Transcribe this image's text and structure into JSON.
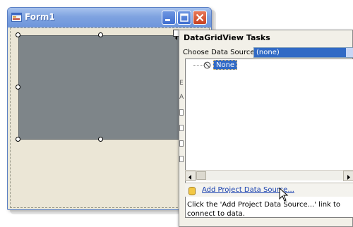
{
  "window": {
    "title": "Form1"
  },
  "smart_tag": {
    "title": "DataGridView Tasks",
    "choose_data_source_label": "Choose Data Source",
    "selected_value": "(none)",
    "tree_item": "None",
    "add_link": "Add Project Data Source...",
    "help_text": "Click the 'Add Project Data Source...' link to connect to data."
  },
  "icons": {
    "app": "form-app-icon",
    "minimize": "minimize-icon",
    "maximize": "maximize-icon",
    "close": "close-icon",
    "none": "no-entry-icon",
    "add_data_source": "database-icon",
    "combo_arrow": "chevron-down-icon",
    "cursor": "mouse-pointer-icon"
  },
  "colors": {
    "titlebar": "#7fa3e0",
    "close_button": "#c84120",
    "selection": "#316ac5",
    "grid_control": "#7e8589",
    "link": "#1840b0"
  }
}
